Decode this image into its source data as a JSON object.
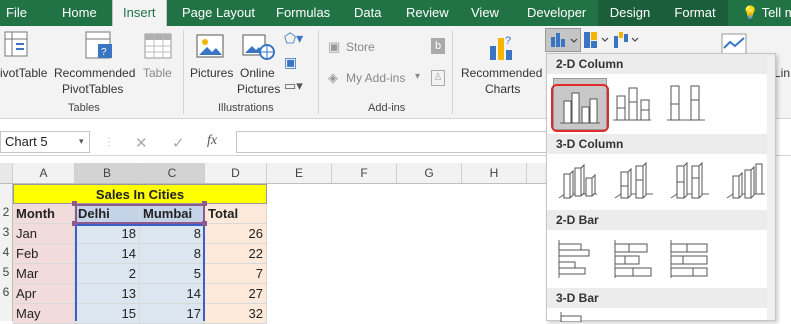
{
  "tabs": [
    "File",
    "Home",
    "Insert",
    "Page Layout",
    "Formulas",
    "Data",
    "Review",
    "View",
    "Developer",
    "Design",
    "Format",
    "Tell m"
  ],
  "ribbon": {
    "pivot": "ivotTable",
    "recommended_pivot": [
      "Recommended",
      "PivotTables"
    ],
    "table": "Table",
    "tables_group": "Tables",
    "pictures": "Pictures",
    "online_pictures": [
      "Online",
      "Pictures"
    ],
    "illustrations_group": "Illustrations",
    "store": "Store",
    "my_addins": "My Add-ins",
    "addins_group": "Add-ins",
    "recommended_charts": [
      "Recommended",
      "Charts"
    ],
    "li": "Lin"
  },
  "formula_bar": {
    "name_box": "Chart 5",
    "fx": "fx",
    "cancel": "✕",
    "enter": "✓"
  },
  "columns": [
    "A",
    "B",
    "C",
    "D",
    "E",
    "F",
    "G",
    "H"
  ],
  "sheet": {
    "title": "Sales In Cities",
    "headers": [
      "Month",
      "Delhi",
      "Mumbai",
      "Total"
    ],
    "rows": [
      [
        "Jan",
        "18",
        "8",
        "26"
      ],
      [
        "Feb",
        "14",
        "8",
        "22"
      ],
      [
        "Mar",
        "2",
        "5",
        "7"
      ],
      [
        "Apr",
        "13",
        "14",
        "27"
      ],
      [
        "May",
        "15",
        "17",
        "32"
      ]
    ]
  },
  "row_nums": [
    "2",
    "3",
    "4",
    "5",
    "6"
  ],
  "chart_menu": {
    "sections": [
      "2-D Column",
      "3-D Column",
      "2-D Bar",
      "3-D Bar"
    ]
  },
  "colors": {
    "excel_green": "#217346",
    "title_fill": "#ffff00",
    "month_fill": "#f2dcdb",
    "delhi_fill": "#dce6f1",
    "total_fill": "#fde9d9",
    "highlight": "#e0292b"
  }
}
